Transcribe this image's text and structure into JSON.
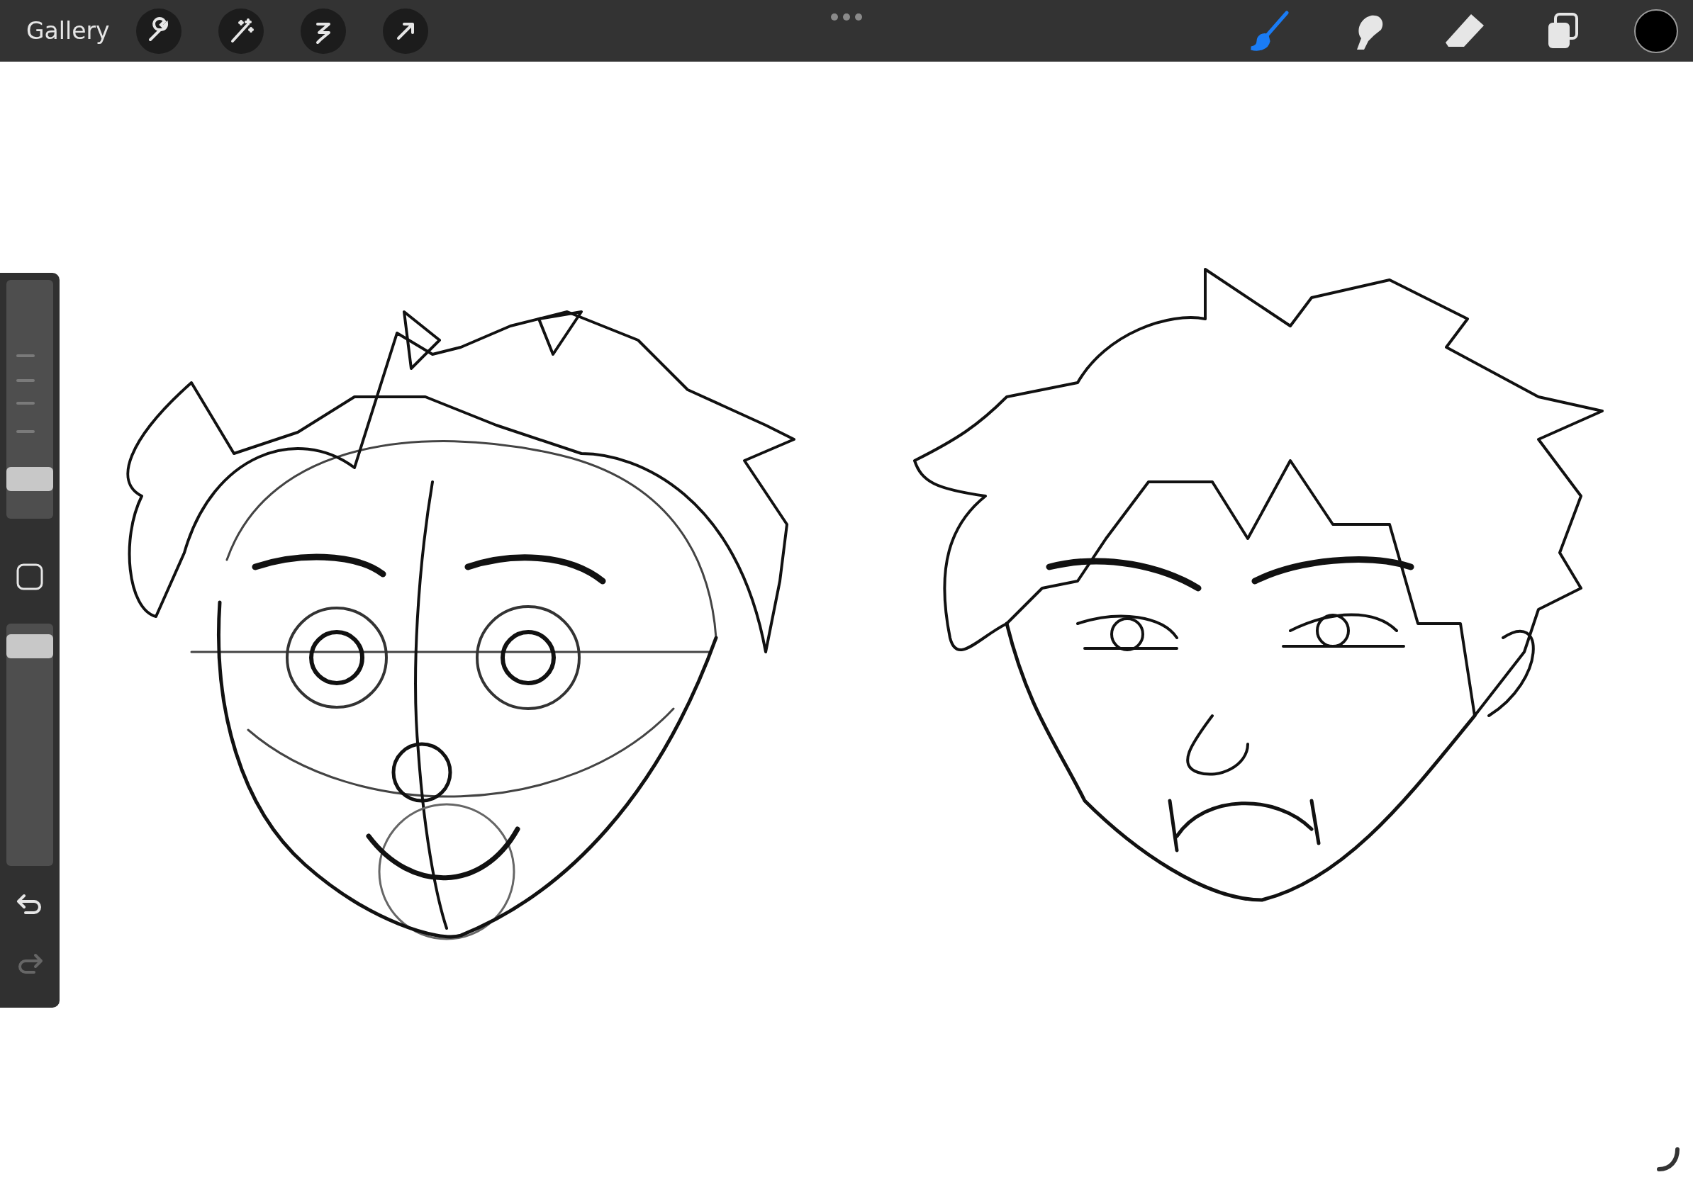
{
  "top_bar": {
    "gallery_label": "Gallery",
    "tools": [
      {
        "kind": "brush",
        "selected": true
      },
      {
        "kind": "smudge",
        "selected": false
      },
      {
        "kind": "eraser",
        "selected": false
      },
      {
        "kind": "layers",
        "selected": false
      }
    ],
    "color_swatch": {
      "color": "#000000"
    }
  },
  "sidebar": {
    "brush_size": {
      "level": 0.13
    },
    "opacity": {
      "level": 0.95
    },
    "redo": {
      "disabled": true
    }
  }
}
